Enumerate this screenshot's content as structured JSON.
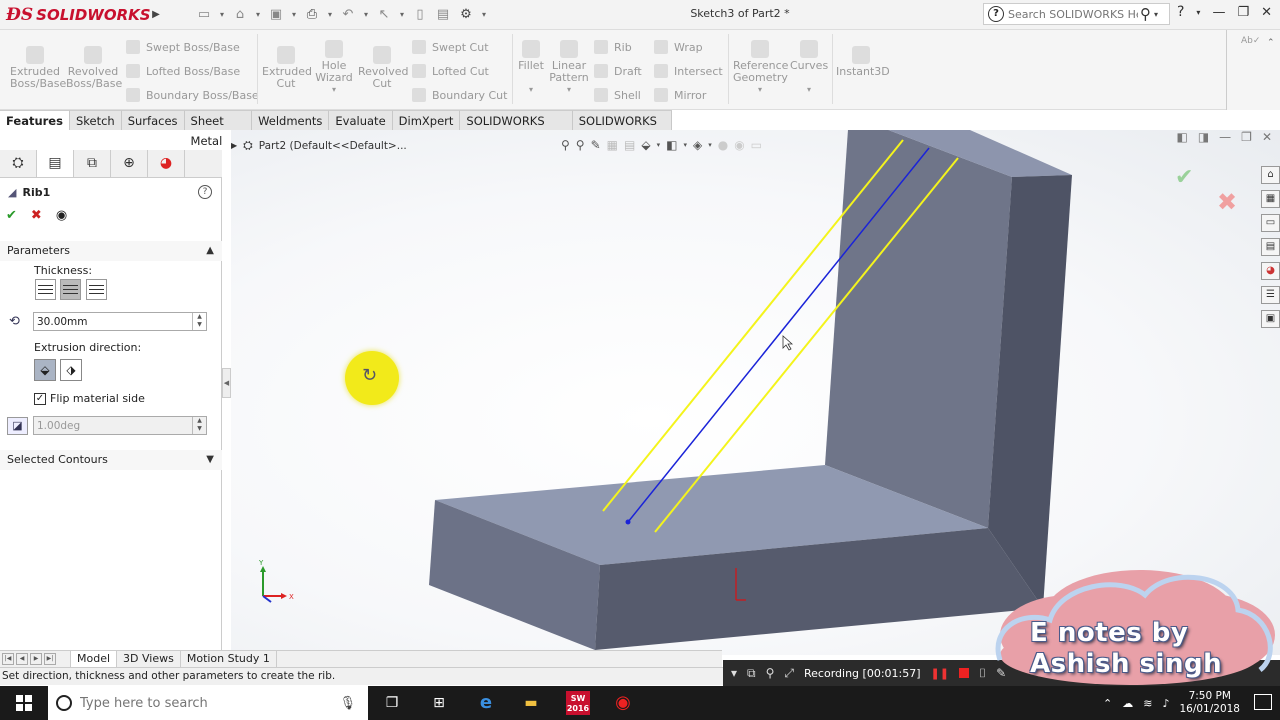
{
  "app": {
    "logo_text": "SOLIDWORKS",
    "document_title": "Sketch3 of Part2 *",
    "search_placeholder": "Search SOLIDWORKS Help"
  },
  "ribbon": {
    "extruded_boss": "Extruded\nBoss/Base",
    "revolved_boss": "Revolved\nBoss/Base",
    "swept_boss": "Swept Boss/Base",
    "lofted_boss": "Lofted Boss/Base",
    "boundary_boss": "Boundary Boss/Base",
    "extruded_cut": "Extruded\nCut",
    "hole_wizard": "Hole\nWizard",
    "revolved_cut": "Revolved\nCut",
    "swept_cut": "Swept Cut",
    "lofted_cut": "Lofted Cut",
    "boundary_cut": "Boundary Cut",
    "fillet": "Fillet",
    "linear_pattern": "Linear\nPattern",
    "rib": "Rib",
    "draft": "Draft",
    "shell": "Shell",
    "wrap": "Wrap",
    "intersect": "Intersect",
    "mirror": "Mirror",
    "reference_geometry": "Reference\nGeometry",
    "curves": "Curves",
    "instant3d": "Instant3D"
  },
  "command_tabs": [
    {
      "label": "Features",
      "active": true
    },
    {
      "label": "Sketch",
      "active": false
    },
    {
      "label": "Surfaces",
      "active": false
    },
    {
      "label": "Sheet Metal",
      "active": false
    },
    {
      "label": "Weldments",
      "active": false
    },
    {
      "label": "Evaluate",
      "active": false
    },
    {
      "label": "DimXpert",
      "active": false
    },
    {
      "label": "SOLIDWORKS Add-Ins",
      "active": false
    },
    {
      "label": "SOLIDWORKS MBD",
      "active": false
    }
  ],
  "property_manager": {
    "feature_name": "Rib1",
    "parameters_title": "Parameters",
    "thickness_label": "Thickness:",
    "thickness_value": "30.00mm",
    "extrusion_direction_label": "Extrusion direction:",
    "flip_material_label": "Flip material side",
    "flip_material_checked": true,
    "draft_value": "1.00deg",
    "selected_contours_title": "Selected Contours"
  },
  "viewport": {
    "tree_item": "Part2  (Default<<Default>..."
  },
  "bottom_tabs": [
    {
      "label": "Model",
      "active": true
    },
    {
      "label": "3D Views",
      "active": false
    },
    {
      "label": "Motion Study 1",
      "active": false
    }
  ],
  "status": {
    "text": "Set direction, thickness and other parameters to create the rib.",
    "recording": "Recording [00:01:57]"
  },
  "taskbar": {
    "search_placeholder": "Type here to search",
    "time": "7:50 PM",
    "date": "16/01/2018",
    "solidworks_badge": "2016"
  },
  "watermark": {
    "line1": "E notes by",
    "line2": "Ashish singh"
  },
  "colors": {
    "brand_red": "#c8102e",
    "part_top": "#8f98b0",
    "part_side": "#5b6072",
    "sketch_yellow": "#f4f41c",
    "sketch_blue": "#1a23d8"
  }
}
